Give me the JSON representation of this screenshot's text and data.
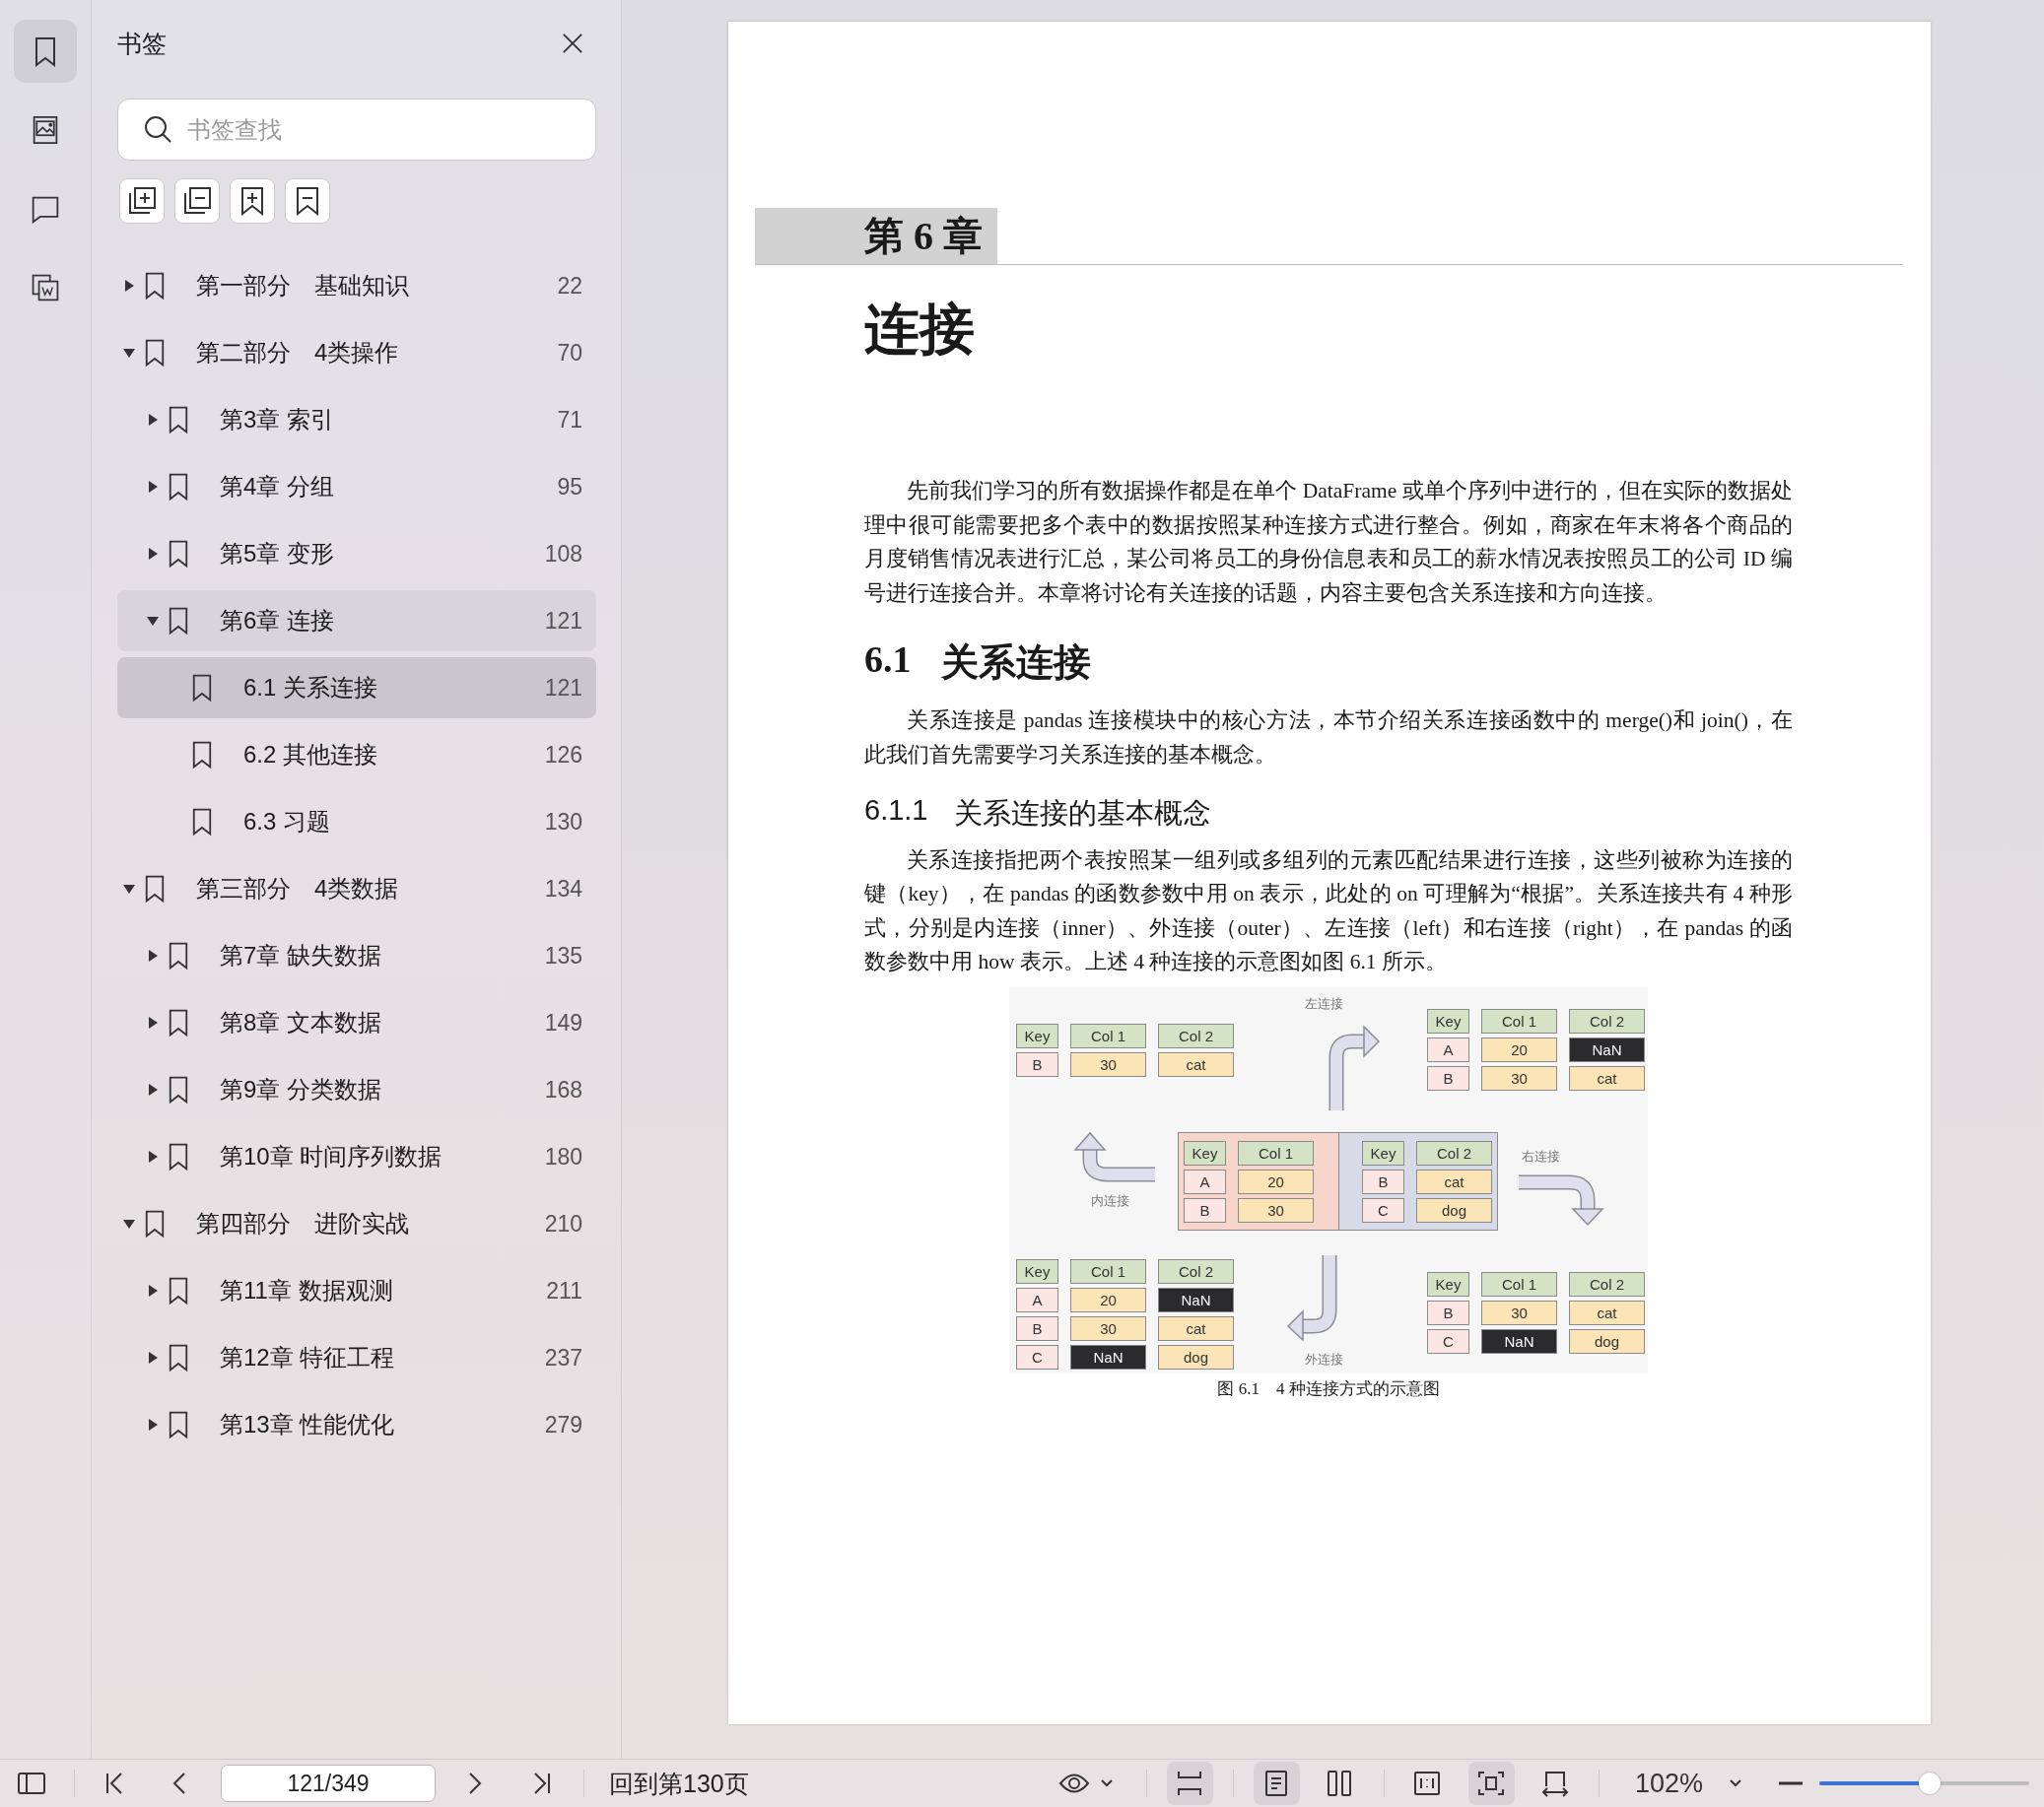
{
  "rail_tabs": [
    {
      "selected": true
    },
    {
      "selected": false
    },
    {
      "selected": false
    },
    {
      "selected": false
    }
  ],
  "bookmarks": {
    "title": "书签",
    "search": {
      "placeholder": "书签查找"
    },
    "items": [
      {
        "label": "第一部分　基础知识",
        "page": "22",
        "expanded": false,
        "selected": false,
        "highlighted": false
      },
      {
        "label": "第二部分　4类操作",
        "page": "70",
        "expanded": true,
        "selected": false,
        "highlighted": false,
        "children": [
          {
            "label": "第3章 索引",
            "page": "71",
            "expanded": false,
            "selected": false,
            "highlighted": false
          },
          {
            "label": "第4章 分组",
            "page": "95",
            "expanded": false,
            "selected": false,
            "highlighted": false
          },
          {
            "label": "第5章 变形",
            "page": "108",
            "expanded": false,
            "selected": false,
            "highlighted": false
          },
          {
            "label": "第6章 连接",
            "page": "121",
            "expanded": true,
            "selected": false,
            "highlighted": true,
            "children": [
              {
                "label": "6.1 关系连接",
                "page": "121",
                "selected": true,
                "highlighted": false
              },
              {
                "label": "6.2 其他连接",
                "page": "126",
                "selected": false,
                "highlighted": false
              },
              {
                "label": "6.3 习题",
                "page": "130",
                "selected": false,
                "highlighted": false
              }
            ]
          }
        ]
      },
      {
        "label": "第三部分　4类数据",
        "page": "134",
        "expanded": true,
        "selected": false,
        "highlighted": false,
        "children": [
          {
            "label": "第7章 缺失数据",
            "page": "135",
            "expanded": false,
            "selected": false,
            "highlighted": false
          },
          {
            "label": "第8章 文本数据",
            "page": "149",
            "expanded": false,
            "selected": false,
            "highlighted": false
          },
          {
            "label": "第9章 分类数据",
            "page": "168",
            "expanded": false,
            "selected": false,
            "highlighted": false
          },
          {
            "label": "第10章 时间序列数据",
            "page": "180",
            "expanded": false,
            "selected": false,
            "highlighted": false
          }
        ]
      },
      {
        "label": "第四部分　进阶实战",
        "page": "210",
        "expanded": true,
        "selected": false,
        "highlighted": false,
        "children": [
          {
            "label": "第11章 数据观测",
            "page": "211",
            "expanded": false,
            "selected": false,
            "highlighted": false
          },
          {
            "label": "第12章 特征工程",
            "page": "237",
            "expanded": false,
            "selected": false,
            "highlighted": false
          },
          {
            "label": "第13章 性能优化",
            "page": "279",
            "expanded": false,
            "selected": false,
            "highlighted": false
          }
        ]
      }
    ]
  },
  "page": {
    "chapter_number": "第 6 章",
    "chapter_title": "连接",
    "blocks": [
      {
        "kind": "paragraph",
        "text": "先前我们学习的所有数据操作都是在单个 DataFrame 或单个序列中进行的，但在实际的数据处理中很可能需要把多个表中的数据按照某种连接方式进行整合。例如，商家在年末将各个商品的月度销售情况表进行汇总，某公司将员工的身份信息表和员工的薪水情况表按照员工的公司 ID 编号进行连接合并。本章将讨论有关连接的话题，内容主要包含关系连接和方向连接。"
      },
      {
        "kind": "section",
        "number": "6.1",
        "title": "关系连接"
      },
      {
        "kind": "paragraph",
        "text": "关系连接是 pandas 连接模块中的核心方法，本节介绍关系连接函数中的 merge()和 join()，在此我们首先需要学习关系连接的基本概念。"
      },
      {
        "kind": "subsection",
        "number": "6.1.1",
        "title": "关系连接的基本概念"
      },
      {
        "kind": "paragraph",
        "text": "关系连接指把两个表按照某一组列或多组列的元素匹配结果进行连接，这些列被称为连接的键（key），在 pandas 的函数参数中用 on 表示，此处的 on 可理解为“根据”。关系连接共有 4 种形式，分别是内连接（inner）、外连接（outer）、左连接（left）和右连接（right），在 pandas 的函数参数中用 how 表示。上述 4 种连接的示意图如图 6.1 所示。"
      },
      {
        "kind": "figure",
        "caption": "图 6.1　4 种连接方式的示意图",
        "sources": [
          {
            "columns": [
              "Key",
              "Col 1"
            ],
            "rows": [
              {
                "key": "A",
                "values": [
                  {
                    "text": "20",
                    "missing": false
                  }
                ]
              },
              {
                "key": "B",
                "values": [
                  {
                    "text": "30",
                    "missing": false
                  }
                ]
              }
            ]
          },
          {
            "columns": [
              "Key",
              "Col 2"
            ],
            "rows": [
              {
                "key": "B",
                "values": [
                  {
                    "text": "cat",
                    "missing": false
                  }
                ]
              },
              {
                "key": "C",
                "values": [
                  {
                    "text": "dog",
                    "missing": false
                  }
                ]
              }
            ]
          }
        ],
        "results": [
          {
            "label": "内连接",
            "columns": [
              "Key",
              "Col 1",
              "Col 2"
            ],
            "rows": [
              {
                "key": "B",
                "values": [
                  {
                    "text": "30",
                    "missing": false
                  },
                  {
                    "text": "cat",
                    "missing": false
                  }
                ]
              }
            ]
          },
          {
            "label": "左连接",
            "columns": [
              "Key",
              "Col 1",
              "Col 2"
            ],
            "rows": [
              {
                "key": "A",
                "values": [
                  {
                    "text": "20",
                    "missing": false
                  },
                  {
                    "text": "NaN",
                    "missing": true
                  }
                ]
              },
              {
                "key": "B",
                "values": [
                  {
                    "text": "30",
                    "missing": false
                  },
                  {
                    "text": "cat",
                    "missing": false
                  }
                ]
              }
            ]
          },
          {
            "label": "右连接",
            "columns": [
              "Key",
              "Col 1",
              "Col 2"
            ],
            "rows": [
              {
                "key": "B",
                "values": [
                  {
                    "text": "30",
                    "missing": false
                  },
                  {
                    "text": "cat",
                    "missing": false
                  }
                ]
              },
              {
                "key": "C",
                "values": [
                  {
                    "text": "NaN",
                    "missing": true
                  },
                  {
                    "text": "dog",
                    "missing": false
                  }
                ]
              }
            ]
          },
          {
            "label": "外连接",
            "columns": [
              "Key",
              "Col 1",
              "Col 2"
            ],
            "rows": [
              {
                "key": "A",
                "values": [
                  {
                    "text": "20",
                    "missing": false
                  },
                  {
                    "text": "NaN",
                    "missing": true
                  }
                ]
              },
              {
                "key": "B",
                "values": [
                  {
                    "text": "30",
                    "missing": false
                  },
                  {
                    "text": "cat",
                    "missing": false
                  }
                ]
              },
              {
                "key": "C",
                "values": [
                  {
                    "text": "NaN",
                    "missing": true
                  },
                  {
                    "text": "dog",
                    "missing": false
                  }
                ]
              }
            ]
          }
        ]
      }
    ]
  },
  "toolbar": {
    "page_field": {
      "value": "121/349"
    },
    "back_link": "回到第130页",
    "zoom": "102%",
    "zoom_slider": {
      "level": 0.5
    },
    "view_buttons": [
      {
        "kind": "continuous",
        "on": true
      },
      {
        "kind": "single",
        "on": true
      },
      {
        "kind": "double",
        "on": false
      },
      {
        "kind": "actual",
        "on": false
      },
      {
        "kind": "fit",
        "on": true
      },
      {
        "kind": "width",
        "on": false
      }
    ]
  }
}
